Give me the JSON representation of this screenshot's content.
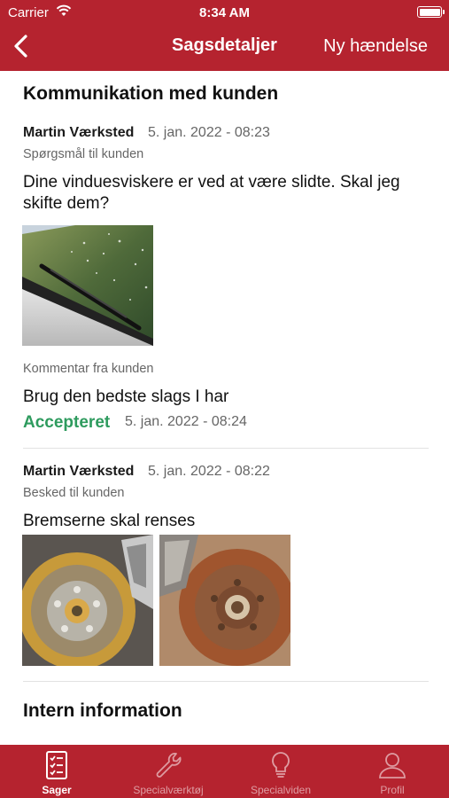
{
  "status_bar": {
    "carrier": "Carrier",
    "time": "8:34 AM"
  },
  "nav": {
    "title": "Sagsdetaljer",
    "action": "Ny hændelse"
  },
  "communication": {
    "title": "Kommunikation med kunden",
    "entries": [
      {
        "author": "Martin Værksted",
        "date": "5. jan. 2022 - 08:23",
        "type": "Spørgsmål til kunden",
        "message": "Dine vinduesviskere er ved at være slidte. Skal jeg skifte dem?",
        "comment_label": "Kommentar fra kunden",
        "comment": "Brug den bedste slags I har",
        "status": "Accepteret",
        "status_date": "5. jan. 2022 - 08:24"
      },
      {
        "author": "Martin Værksted",
        "date": "5. jan. 2022 - 08:22",
        "type": "Besked til kunden",
        "message": "Bremserne skal renses"
      }
    ]
  },
  "internal": {
    "title": "Intern information"
  },
  "tabs": [
    {
      "label": "Sager",
      "icon": "checklist-icon",
      "active": true
    },
    {
      "label": "Specialværktøj",
      "icon": "wrench-icon",
      "active": false
    },
    {
      "label": "Specialviden",
      "icon": "lightbulb-icon",
      "active": false
    },
    {
      "label": "Profil",
      "icon": "person-icon",
      "active": false
    }
  ],
  "colors": {
    "brand": "#b5232f",
    "accepted": "#2e9b5e"
  }
}
